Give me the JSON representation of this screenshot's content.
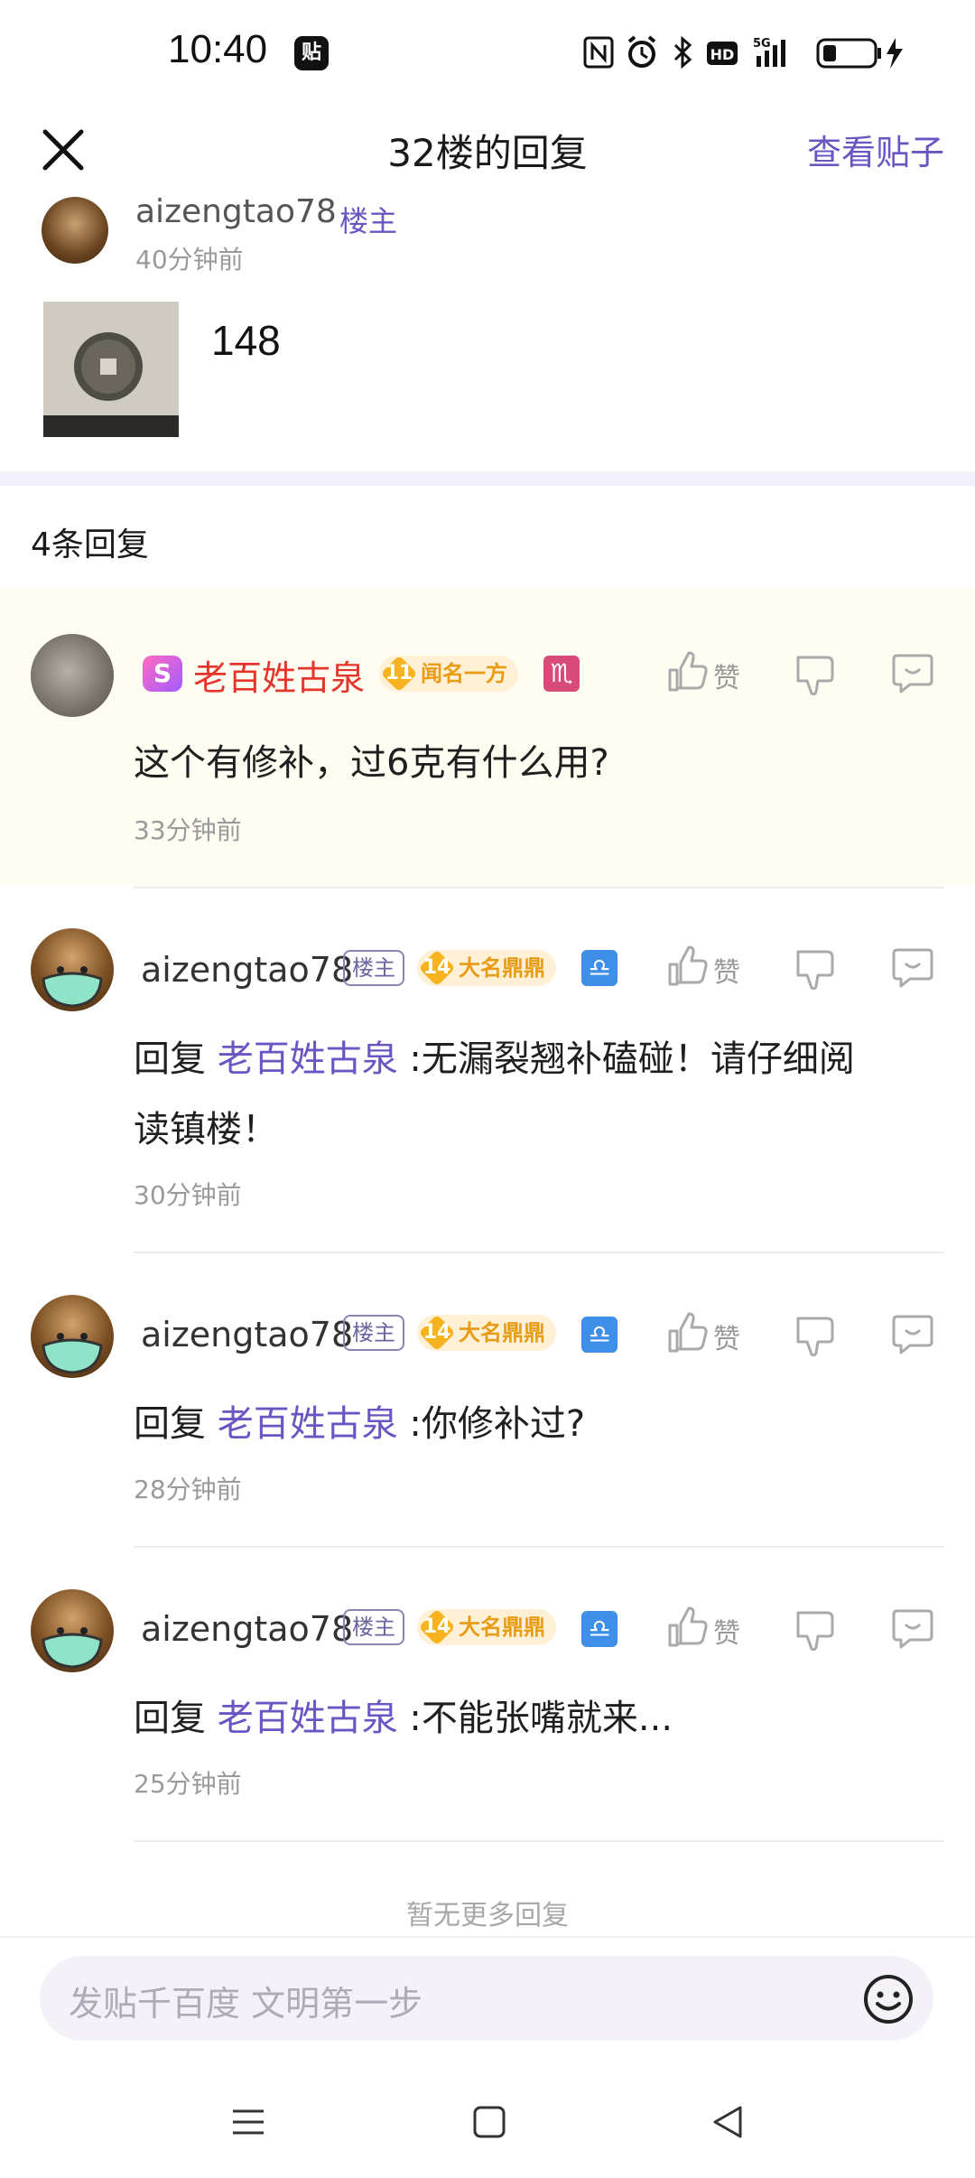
{
  "status_bar": {
    "time": "10:40",
    "app_icon_text": "贴"
  },
  "header": {
    "title": "32楼的回复",
    "view_post": "查看贴子"
  },
  "op": {
    "name": "aizengtao78",
    "badge": "楼主",
    "time": "40分钟前",
    "content": "148"
  },
  "reply_count": "4条回复",
  "replies": [
    {
      "name": "老百姓古泉",
      "badge_s": "S",
      "level": "11",
      "level_title": "闻名一方",
      "zodiac": "♏",
      "like": "赞",
      "text": "这个有修补，过6克有什么用?",
      "time": "33分钟前"
    },
    {
      "name": "aizengtao78",
      "floor": "楼主",
      "level": "14",
      "level_title": "大名鼎鼎",
      "zodiac": "♎",
      "like": "赞",
      "reply_prefix": "回复 ",
      "mention": "老百姓古泉",
      "text_line1": " :无漏裂翘补磕碰！请仔细阅",
      "text_line2": "读镇楼！",
      "time": "30分钟前"
    },
    {
      "name": "aizengtao78",
      "floor": "楼主",
      "level": "14",
      "level_title": "大名鼎鼎",
      "zodiac": "♎",
      "like": "赞",
      "reply_prefix": "回复 ",
      "mention": "老百姓古泉",
      "text": " :你修补过?",
      "time": "28分钟前"
    },
    {
      "name": "aizengtao78",
      "floor": "楼主",
      "level": "14",
      "level_title": "大名鼎鼎",
      "zodiac": "♎",
      "like": "赞",
      "reply_prefix": "回复 ",
      "mention": "老百姓古泉",
      "text": " :不能张嘴就来...",
      "time": "25分钟前"
    }
  ],
  "no_more": "暂无更多回复",
  "input": {
    "placeholder": "发贴千百度 文明第一步"
  },
  "colors": {
    "accent": "#6b55c3",
    "highlight_bg": "#fffdf1",
    "red_name": "#e5352b"
  }
}
